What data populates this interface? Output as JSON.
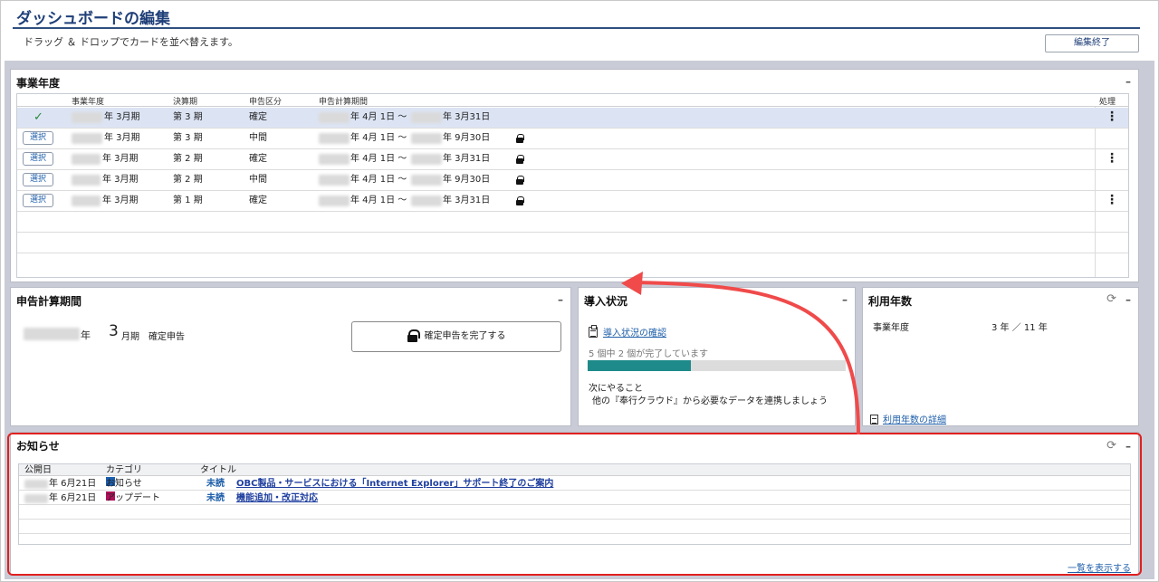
{
  "header": {
    "title": "ダッシュボードの編集",
    "subtitle": "ドラッグ ＆ ドロップでカードを並べ替えます。",
    "end_button": "編集終了"
  },
  "fiscal_card": {
    "title": "事業年度",
    "minimize": "–",
    "columns": [
      "事業年度",
      "決算期",
      "申告区分",
      "申告計算期間",
      "処理"
    ],
    "choose_label": "選択",
    "rows": [
      {
        "year": "年 3月期",
        "term": "第 3 期",
        "type": "確定",
        "start": "年 4月 1日 ～",
        "end": "年 3月31日",
        "selected": true,
        "locked": false,
        "menu": true
      },
      {
        "year": "年 3月期",
        "term": "第 3 期",
        "type": "中間",
        "start": "年 4月 1日 ～",
        "end": "年 9月30日",
        "selected": false,
        "locked": true,
        "menu": false
      },
      {
        "year": "年 3月期",
        "term": "第 2 期",
        "type": "確定",
        "start": "年 4月 1日 ～",
        "end": "年 3月31日",
        "selected": false,
        "locked": true,
        "menu": true
      },
      {
        "year": "年 3月期",
        "term": "第 2 期",
        "type": "中間",
        "start": "年 4月 1日 ～",
        "end": "年 9月30日",
        "selected": false,
        "locked": true,
        "menu": false
      },
      {
        "year": "年 3月期",
        "term": "第 1 期",
        "type": "確定",
        "start": "年 4月 1日 ～",
        "end": "年 3月31日",
        "selected": false,
        "locked": true,
        "menu": true
      }
    ],
    "check_glyph": "✓",
    "kebab_glyph": "⋮"
  },
  "period_card": {
    "title": "申告計算期間",
    "minimize": "–",
    "year_suffix": "年",
    "month": "3",
    "month_suffix": "月期",
    "type": "確定申告",
    "complete_button": "確定申告を完了する"
  },
  "intro_card": {
    "title": "導入状況",
    "minimize": "–",
    "check_link": "導入状況の確認",
    "progress_text": "5 個中 2 個が完了しています",
    "progress": 0.4,
    "next_label": "次にやること",
    "next_text": "他の『奉行クラウド』から必要なデータを連携しましょう"
  },
  "usage_card": {
    "title": "利用年数",
    "minimize": "–",
    "refresh_glyph": "⟳",
    "label": "事業年度",
    "value": "3 年 ／ 11 年",
    "detail_link": "利用年数の詳細"
  },
  "notice_card": {
    "title": "お知らせ",
    "minimize": "–",
    "refresh_glyph": "⟳",
    "columns": [
      "公開日",
      "カテゴリ",
      "タイトル"
    ],
    "rows": [
      {
        "date": "年  6月21日",
        "category": "お知らせ",
        "color": "#1a5fb0",
        "status": "未読",
        "title": "OBC製品・サービスにおける「Internet Explorer」サポート終了のご案内"
      },
      {
        "date": "年  6月21日",
        "category": "アップデート",
        "color": "#b0105a",
        "status": "未読",
        "title": "機能追加・改正対応"
      }
    ],
    "view_all": "一覧を表示する"
  }
}
